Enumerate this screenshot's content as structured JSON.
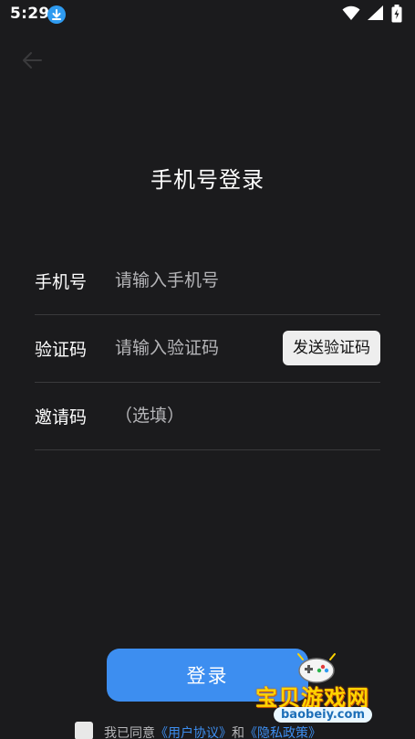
{
  "status_bar": {
    "time": "5:29",
    "icons": [
      "download-icon",
      "wifi-icon",
      "signal-icon",
      "battery-icon"
    ]
  },
  "header": {
    "title": "手机号登录",
    "back_icon": "arrow-left-icon"
  },
  "form": {
    "phone": {
      "label": "手机号",
      "placeholder": "请输入手机号"
    },
    "code": {
      "label": "验证码",
      "placeholder": "请输入验证码",
      "send_button": "发送验证码"
    },
    "invite": {
      "label": "邀请码",
      "placeholder": "（选填）"
    }
  },
  "login_button": "登录",
  "agreement": {
    "prefix": "我已同意",
    "user_agreement": "《用户协议》",
    "conjunction": "和",
    "privacy_policy": "《隐私政策》"
  },
  "watermark": {
    "title": "宝贝游戏网",
    "url": "baobeiy.com"
  },
  "colors": {
    "background": "#1b1b1d",
    "accent": "#3d8ef0",
    "divider": "#3a3a3c",
    "watermark": "#ffd400"
  }
}
